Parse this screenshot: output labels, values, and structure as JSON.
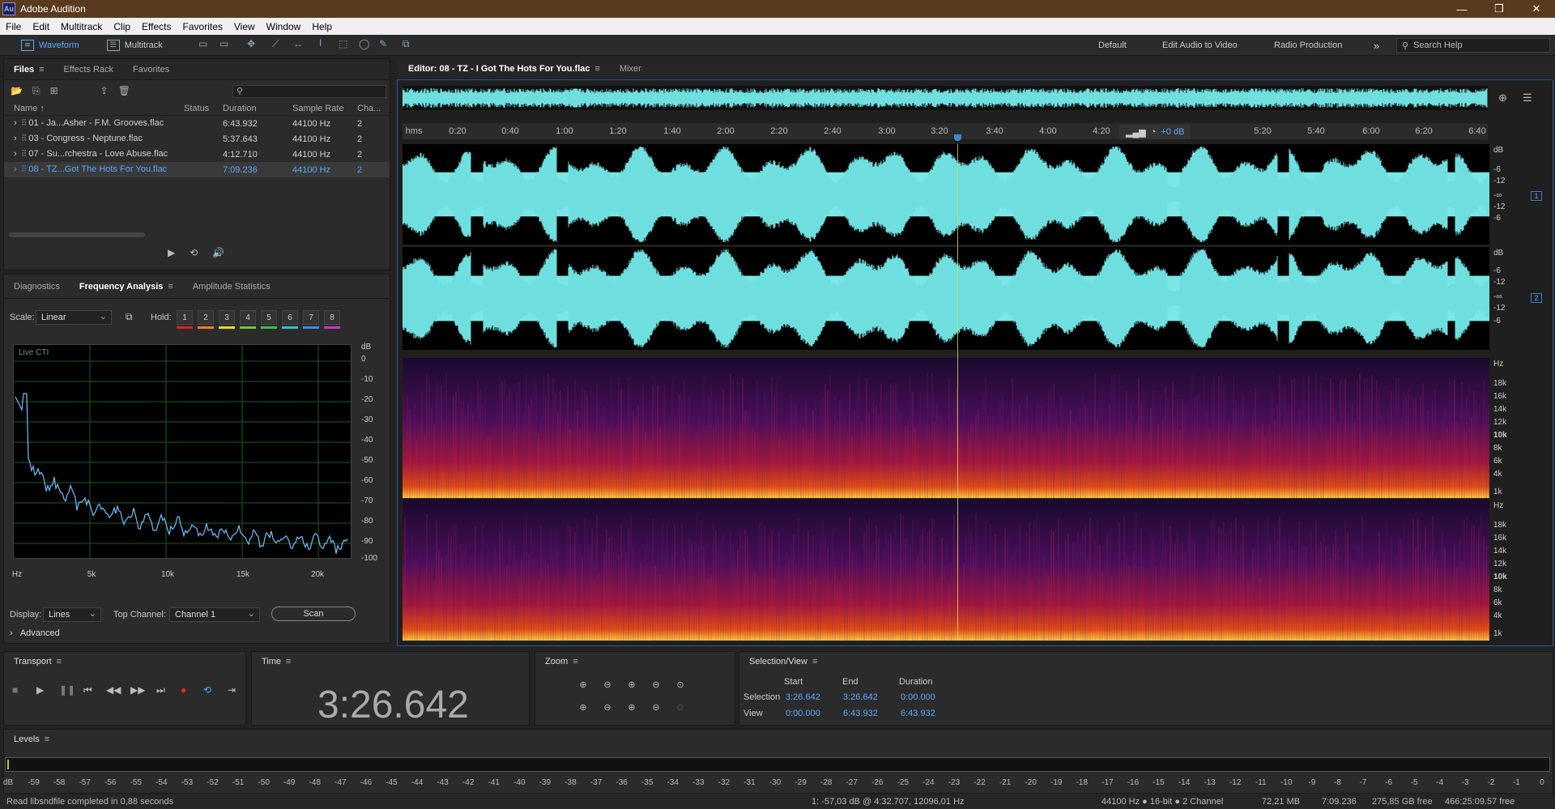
{
  "app": {
    "title": "Adobe Audition",
    "logo": "Au",
    "window_buttons": {
      "minimize": "—",
      "restore": "❐",
      "close": "✕"
    }
  },
  "menu": [
    "File",
    "Edit",
    "Multitrack",
    "Clip",
    "Effects",
    "Favorites",
    "View",
    "Window",
    "Help"
  ],
  "toolbar": {
    "waveform": "Waveform",
    "multitrack": "Multitrack",
    "workspaces": [
      "Default",
      "Edit Audio to Video",
      "Radio Production"
    ],
    "more": "»",
    "search_placeholder": "Search Help"
  },
  "files_panel": {
    "tabs": [
      "Files",
      "Effects Rack",
      "Favorites"
    ],
    "columns": [
      "Name ↑",
      "Status",
      "Duration",
      "Sample Rate",
      "Cha..."
    ],
    "rows": [
      {
        "name": "01 - Ja...Asher - F.M. Grooves.flac",
        "status": "",
        "duration": "6:43.932",
        "rate": "44100 Hz",
        "ch": "2"
      },
      {
        "name": "03 - Congress - Neptune.flac",
        "status": "",
        "duration": "5:37.643",
        "rate": "44100 Hz",
        "ch": "2"
      },
      {
        "name": "07 - Su...rchestra - Love Abuse.flac",
        "status": "",
        "duration": "4:12.710",
        "rate": "44100 Hz",
        "ch": "2"
      },
      {
        "name": "08 - TZ...Got The Hots For You.flac",
        "status": "",
        "duration": "7:09.236",
        "rate": "44100 Hz",
        "ch": "2"
      }
    ]
  },
  "analysis_panel": {
    "tabs": [
      "Diagnostics",
      "Frequency Analysis",
      "Amplitude Statistics"
    ],
    "scale_label": "Scale:",
    "scale_value": "Linear",
    "hold_label": "Hold:",
    "holds": [
      "1",
      "2",
      "3",
      "4",
      "5",
      "6",
      "7",
      "8"
    ],
    "hold_colors": [
      "#e02020",
      "#f08020",
      "#e0e020",
      "#60d030",
      "#30c050",
      "#20c8d0",
      "#3090f0",
      "#d030d0"
    ],
    "graph_label": "Live CTI",
    "y_unit": "dB",
    "y_ticks": [
      "0",
      "-10",
      "-20",
      "-30",
      "-40",
      "-50",
      "-60",
      "-70",
      "-80",
      "-90",
      "-100"
    ],
    "x_ticks": [
      "Hz",
      "5k",
      "10k",
      "15k",
      "20k"
    ],
    "display_label": "Display:",
    "display_value": "Lines",
    "top_channel_label": "Top Channel:",
    "top_channel_value": "Channel 1",
    "scan_label": "Scan",
    "advanced_label": "Advanced"
  },
  "editor": {
    "tab": "Editor: 08 - TZ - I Got The Hots For You.flac",
    "mixer": "Mixer",
    "ruler_unit": "hms",
    "ruler_ticks": [
      "0:20",
      "0:40",
      "1:00",
      "1:20",
      "1:40",
      "2:00",
      "2:20",
      "2:40",
      "3:00",
      "3:20",
      "3:40",
      "4:00",
      "4:20",
      "5:20",
      "5:40",
      "6:00",
      "6:20",
      "6:40"
    ],
    "gain": "+0 dB",
    "wave_db_unit": "dB",
    "wave_db_ticks": [
      "-6",
      "-12",
      "-∞",
      "-12",
      "-6"
    ],
    "spec_unit": "Hz",
    "spec_ticks": [
      "18k",
      "16k",
      "14k",
      "12k",
      "10k",
      "8k",
      "6k",
      "4k",
      "1k"
    ],
    "channels": [
      "1",
      "2"
    ]
  },
  "transport": {
    "title": "Transport",
    "buttons": [
      "■",
      "▶",
      "❚❚",
      "⏮",
      "◀◀",
      "▶▶",
      "⏭",
      "●",
      "⟲",
      "⇥"
    ]
  },
  "time": {
    "title": "Time",
    "value": "3:26.642"
  },
  "zoom": {
    "title": "Zoom"
  },
  "selection_view": {
    "title": "Selection/View",
    "headers": [
      "Start",
      "End",
      "Duration"
    ],
    "selection_label": "Selection",
    "selection": [
      "3:26.642",
      "3:26.642",
      "0:00.000"
    ],
    "view_label": "View",
    "view": [
      "0:00.000",
      "6:43.932",
      "6:43.932"
    ]
  },
  "levels": {
    "title": "Levels",
    "ticks": [
      "dB",
      "-59",
      "-58",
      "-57",
      "-56",
      "-55",
      "-54",
      "-53",
      "-52",
      "-51",
      "-50",
      "-49",
      "-48",
      "-47",
      "-46",
      "-45",
      "-44",
      "-43",
      "-42",
      "-41",
      "-40",
      "-39",
      "-38",
      "-37",
      "-36",
      "-35",
      "-34",
      "-33",
      "-32",
      "-31",
      "-30",
      "-29",
      "-28",
      "-27",
      "-26",
      "-25",
      "-24",
      "-23",
      "-22",
      "-21",
      "-20",
      "-19",
      "-18",
      "-17",
      "-16",
      "-15",
      "-14",
      "-13",
      "-12",
      "-11",
      "-10",
      "-9",
      "-8",
      "-7",
      "-6",
      "-5",
      "-4",
      "-3",
      "-2",
      "-1",
      "0"
    ]
  },
  "status": {
    "left": "Read libsndfile completed in 0,88 seconds",
    "cursor": "1: -57,03 dB @ 4:32.707, 12096,01 Hz",
    "format": "44100 Hz ● 16-bit ● 2 Channel",
    "size": "72,21 MB",
    "duration": "7:09.236",
    "free": "275,85 GB free",
    "free_time": "466:25:09.57 free"
  }
}
